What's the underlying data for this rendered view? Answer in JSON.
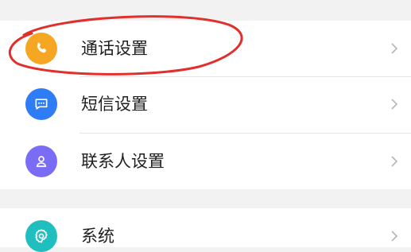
{
  "settings": {
    "items": [
      {
        "label": "通话设置",
        "icon": "phone-icon",
        "color": "#f5a623"
      },
      {
        "label": "短信设置",
        "icon": "message-icon",
        "color": "#2e7cf6"
      },
      {
        "label": "联系人设置",
        "icon": "contact-icon",
        "color": "#7b6cf6"
      }
    ],
    "system": {
      "label": "系统",
      "icon": "gear-icon",
      "color": "#1fbfc0"
    }
  },
  "annotation": {
    "shape": "ellipse",
    "color": "#e0302c",
    "target": "通话设置"
  }
}
